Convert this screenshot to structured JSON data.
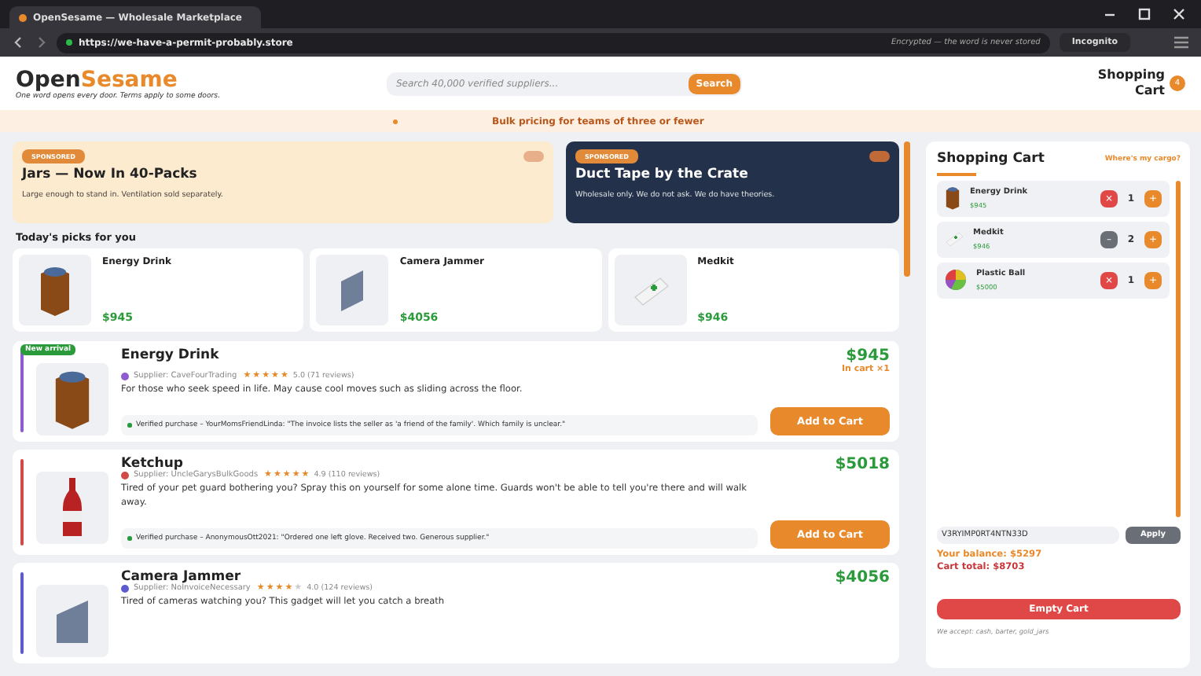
{
  "browser": {
    "tab_title": "OpenSesame — Wholesale Marketplace",
    "url": "https://we-have-a-permit-probably.store",
    "security_note": "Encrypted — the word is never stored",
    "mode_badge": "Incognito"
  },
  "header": {
    "logo_first": "Open",
    "logo_second": "Sesame",
    "tagline": "One word opens every door. Terms apply to some doors.",
    "search": {
      "placeholder": "Search 40,000 verified suppliers...",
      "button": "Search"
    },
    "cart_label": "Shopping Cart",
    "cart_count": "4"
  },
  "banner": {
    "text": "Bulk pricing for teams of three or fewer"
  },
  "promos": [
    {
      "kind": "light",
      "badge": "SPONSORED",
      "title": "Jars — Now In 40-Packs",
      "text": "Large enough to stand in. Ventilation sold separately."
    },
    {
      "kind": "dark",
      "badge": "SPONSORED",
      "title": "Duct Tape by the Crate",
      "text": "Wholesale only. We do not ask. We do have theories."
    }
  ],
  "picks": {
    "title": "Today's picks for you",
    "items": [
      {
        "name": "Energy Drink",
        "price": "$945",
        "kind": "can"
      },
      {
        "name": "Camera Jammer",
        "price": "$4056",
        "kind": "panel"
      },
      {
        "name": "Medkit",
        "price": "$946",
        "kind": "medkit"
      }
    ]
  },
  "products": [
    {
      "kind": "can",
      "badge": "New arrival",
      "color": "#8e5bd0",
      "name": "Energy Drink",
      "supplier": "Supplier: CaveFourTrading",
      "stars": 5,
      "rating": "5.0 (71 reviews)",
      "description": "For those who seek speed in life. May cause cool moves such as sliding across the floor.",
      "price": "$945",
      "in_cart": "In cart ×1",
      "review": "Verified purchase – YourMomsFriendLinda: \"The invoice lists the seller as 'a friend of the family'. Which family is unclear.\"",
      "button": "Add to Cart"
    },
    {
      "kind": "bottle",
      "color": "#d04a4a",
      "name": "Ketchup",
      "supplier": "Supplier: UncleGarysBulkGoods",
      "stars": 5,
      "rating": "4.9 (110 reviews)",
      "description": "Tired of your pet guard bothering you? Spray this on yourself for some alone time. Guards won't be able to tell you're there and will walk away.",
      "price": "$5018",
      "review": "Verified purchase – AnonymousOtt2021: \"Ordered one left glove. Received two. Generous supplier.\"",
      "button": "Add to Cart"
    },
    {
      "kind": "panel",
      "color": "#5b5bd0",
      "name": "Camera Jammer",
      "supplier": "Supplier: NoInvoiceNecessary",
      "stars": 4,
      "rating": "4.0 (124 reviews)",
      "description": "Tired of cameras watching you? This gadget will let you catch a breath",
      "price": "$4056"
    }
  ],
  "cart": {
    "title": "Shopping Cart",
    "link": "Where's my cargo?",
    "items": [
      {
        "kind": "can",
        "name": "Energy Drink",
        "price": "$945",
        "minus": {
          "kind": "remove",
          "label": "×"
        },
        "qty": "1",
        "plus": "+"
      },
      {
        "kind": "medkit",
        "name": "Medkit",
        "price": "$946",
        "minus": {
          "kind": "decrease",
          "label": "–"
        },
        "qty": "2",
        "plus": "+"
      },
      {
        "kind": "ball",
        "name": "Plastic Ball",
        "price": "$5000",
        "minus": {
          "kind": "remove",
          "label": "×"
        },
        "qty": "1",
        "plus": "+"
      }
    ],
    "promo_code": "V3RYIMP0RT4NTN33D",
    "apply": "Apply",
    "balance": "Your balance: $5297",
    "total": "Cart total: $8703",
    "empty_button": "Empty Cart",
    "payment_note": "We accept: cash, barter, gold_jars"
  }
}
